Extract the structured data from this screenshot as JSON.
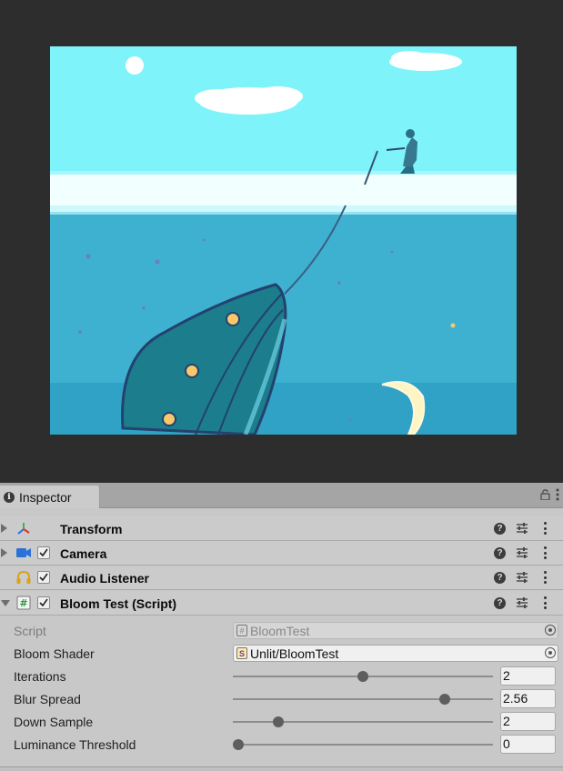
{
  "inspector": {
    "tab_label": "Inspector",
    "components": [
      {
        "title": "Transform",
        "icon": "transform-icon",
        "has_checkbox": false,
        "expanded": false
      },
      {
        "title": "Camera",
        "icon": "camera-icon",
        "has_checkbox": true,
        "checked": true,
        "expanded": false
      },
      {
        "title": "Audio Listener",
        "icon": "headphones-icon",
        "has_checkbox": true,
        "checked": true,
        "expanded": false
      },
      {
        "title": "Bloom Test (Script)",
        "icon": "script-hash-icon",
        "has_checkbox": true,
        "checked": true,
        "expanded": true
      }
    ],
    "properties": {
      "script": {
        "label": "Script",
        "value": "BloomTest"
      },
      "bloom_shader": {
        "label": "Bloom Shader",
        "value": "Unlit/BloomTest"
      },
      "iterations": {
        "label": "Iterations",
        "value": "2",
        "fraction": 0.5
      },
      "blur_spread": {
        "label": "Blur Spread",
        "value": "2.56",
        "fraction": 0.83
      },
      "down_sample": {
        "label": "Down Sample",
        "value": "2",
        "fraction": 0.16
      },
      "luminance_threshold": {
        "label": "Luminance Threshold",
        "value": "0",
        "fraction": 0.0
      }
    }
  },
  "colors": {
    "sky": "#7ef3fa",
    "water": "#3eb1d1",
    "whale": "#1c7d8c",
    "editor_bg": "#2d2d2d",
    "panel_bg": "#c8c8c8"
  }
}
